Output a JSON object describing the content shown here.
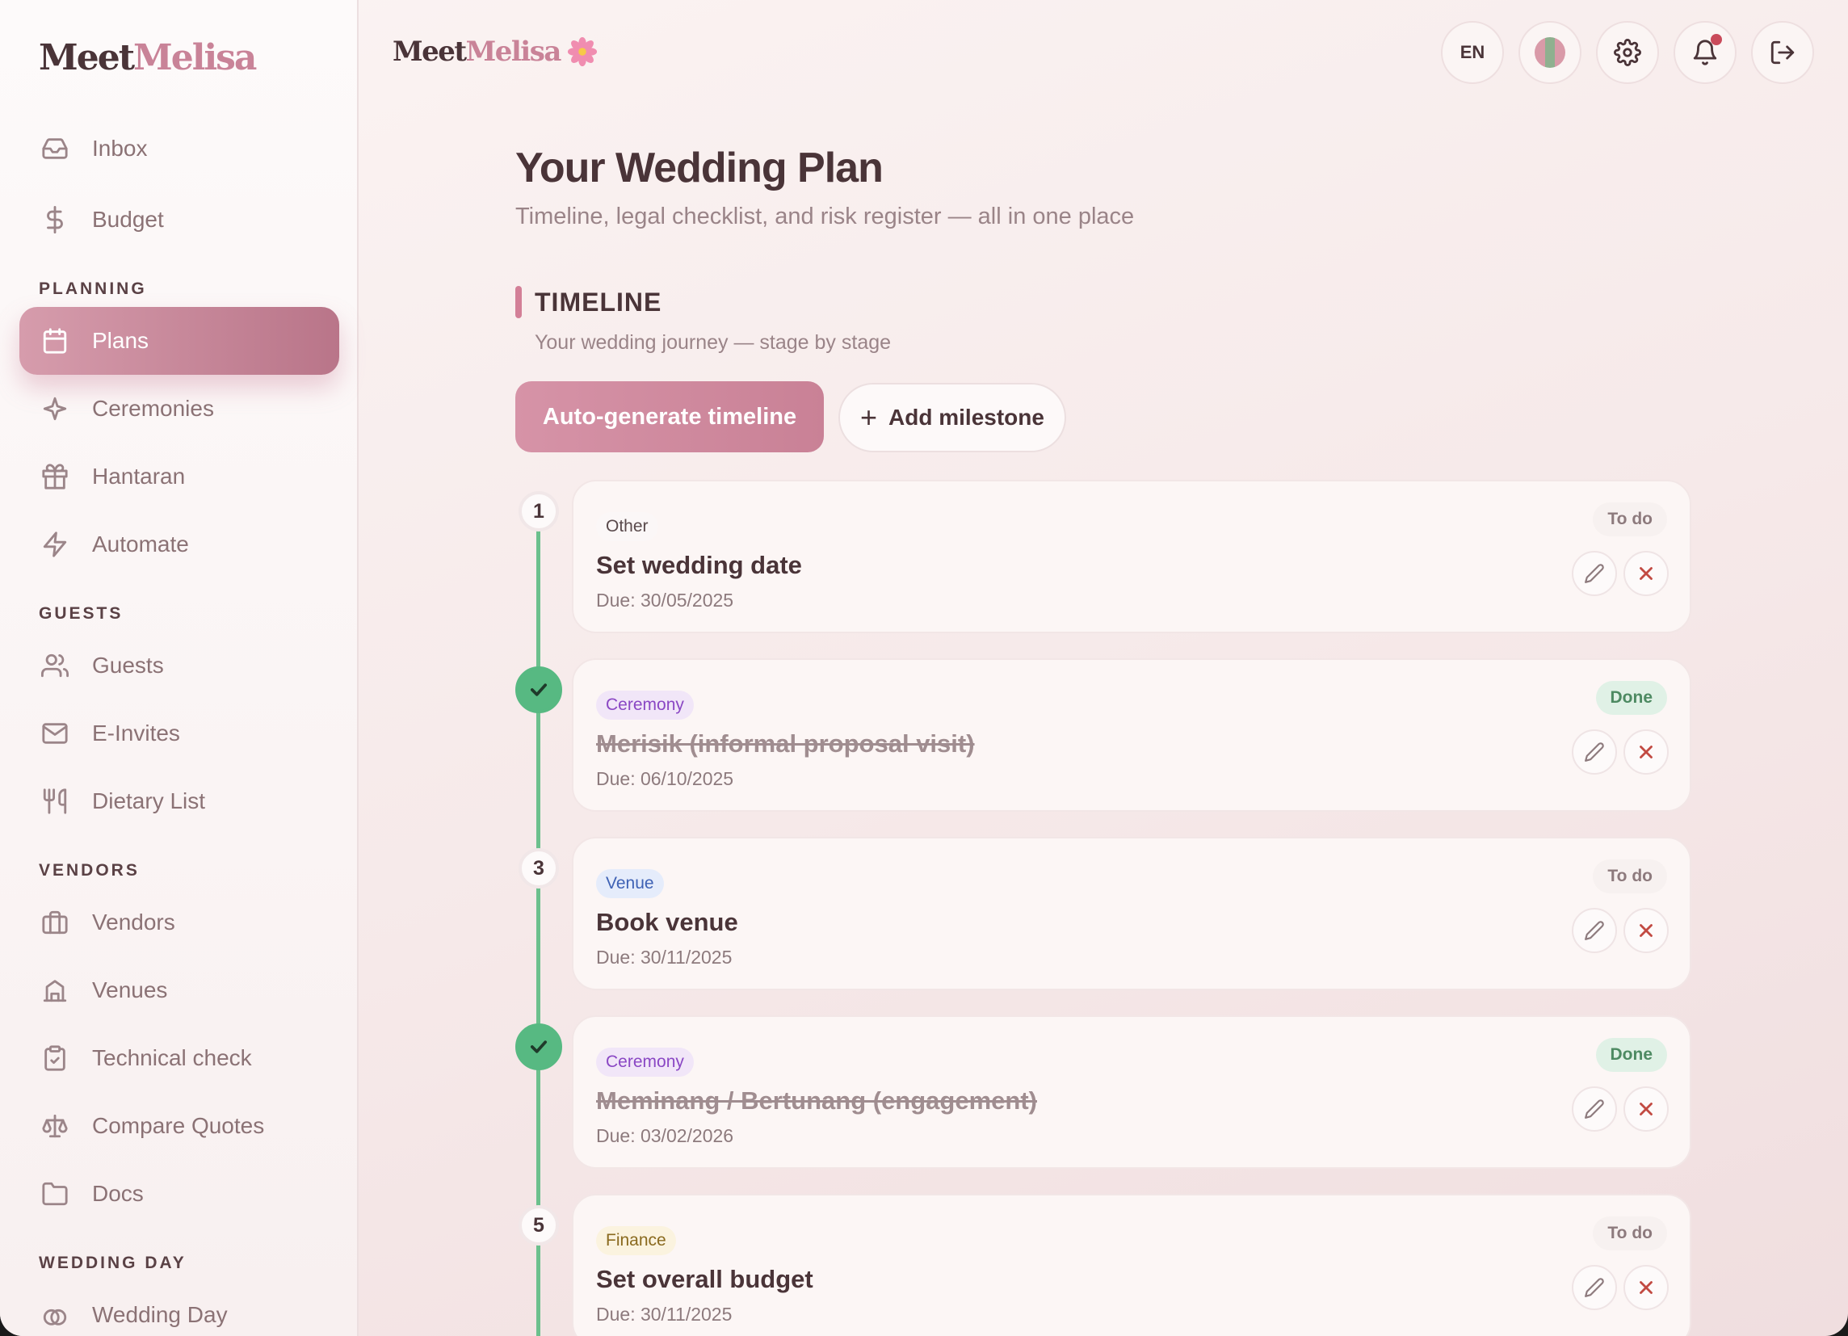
{
  "brand": {
    "part1": "Meet",
    "part2": "Melisa"
  },
  "sidebar": {
    "items": [
      {
        "label": "Inbox",
        "icon": "inbox-icon"
      },
      {
        "label": "Budget",
        "icon": "dollar-icon"
      },
      {
        "label": "Plans",
        "icon": "calendar-icon",
        "active": true
      },
      {
        "label": "Ceremonies",
        "icon": "sparkle-icon"
      },
      {
        "label": "Hantaran",
        "icon": "gift-icon"
      },
      {
        "label": "Automate",
        "icon": "lightning-icon"
      },
      {
        "label": "Guests",
        "icon": "users-icon"
      },
      {
        "label": "E-Invites",
        "icon": "mail-icon"
      },
      {
        "label": "Dietary List",
        "icon": "utensils-icon"
      },
      {
        "label": "Vendors",
        "icon": "briefcase-icon"
      },
      {
        "label": "Venues",
        "icon": "building-icon"
      },
      {
        "label": "Technical check",
        "icon": "clipboard-check-icon"
      },
      {
        "label": "Compare Quotes",
        "icon": "scale-icon"
      },
      {
        "label": "Docs",
        "icon": "folder-icon"
      },
      {
        "label": "Wedding Day",
        "icon": "rings-icon"
      }
    ],
    "sections": {
      "planning": "PLANNING",
      "guests": "GUESTS",
      "vendors": "VENDORS",
      "wedding_day": "WEDDING DAY"
    }
  },
  "topbar": {
    "language": "EN",
    "notification_unread": true
  },
  "main": {
    "title": "Your Wedding Plan",
    "subtitle": "Timeline, legal checklist, and risk register — all in one place",
    "timeline": {
      "title": "TIMELINE",
      "subtitle": "Your wedding journey — stage by stage",
      "auto_button": "Auto-generate timeline",
      "add_button": "Add milestone",
      "milestones": [
        {
          "step": "1",
          "category": "Other",
          "title": "Set wedding date",
          "due": "Due: 30/05/2025",
          "status": "To do",
          "done": false
        },
        {
          "step": "2",
          "category": "Ceremony",
          "title": "Merisik (informal proposal visit)",
          "due": "Due: 06/10/2025",
          "status": "Done",
          "done": true
        },
        {
          "step": "3",
          "category": "Venue",
          "title": "Book venue",
          "due": "Due: 30/11/2025",
          "status": "To do",
          "done": false
        },
        {
          "step": "4",
          "category": "Ceremony",
          "title": "Meminang / Bertunang (engagement)",
          "due": "Due: 03/02/2026",
          "status": "Done",
          "done": true
        },
        {
          "step": "5",
          "category": "Finance",
          "title": "Set overall budget",
          "due": "Due: 30/11/2025",
          "status": "To do",
          "done": false
        }
      ]
    }
  }
}
